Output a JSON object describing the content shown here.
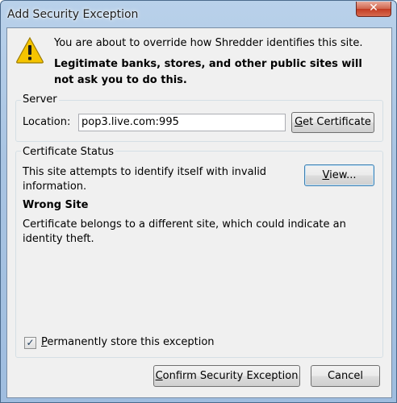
{
  "window": {
    "title": "Add Security Exception",
    "close_label": "✕"
  },
  "warning": {
    "icon": "warning-icon",
    "line1": "You are about to override how Shredder identifies this site.",
    "line2": "Legitimate banks, stores, and other public sites will not ask you to do this."
  },
  "server": {
    "legend": "Server",
    "location_label": "Location:",
    "location_value": "pop3.live.com:995",
    "get_cert_accel": "G",
    "get_cert_rest": "et Certificate"
  },
  "status": {
    "legend": "Certificate Status",
    "description": "This site attempts to identify itself with invalid information.",
    "view_accel": "V",
    "view_rest": "iew...",
    "problem_title": "Wrong Site",
    "problem_detail": "Certificate belongs to a different site, which could indicate an identity theft."
  },
  "permanent": {
    "checked": true,
    "check_glyph": "✓",
    "label_accel": "P",
    "label_rest": "ermanently store this exception"
  },
  "buttons": {
    "confirm_accel": "C",
    "confirm_rest": "onfirm Security Exception",
    "cancel": "Cancel"
  },
  "colors": {
    "titlebar": "#a9c4e2",
    "dialog_bg": "#f0f0f0",
    "close_button": "#c23b22",
    "warning_yellow": "#f5c400"
  }
}
